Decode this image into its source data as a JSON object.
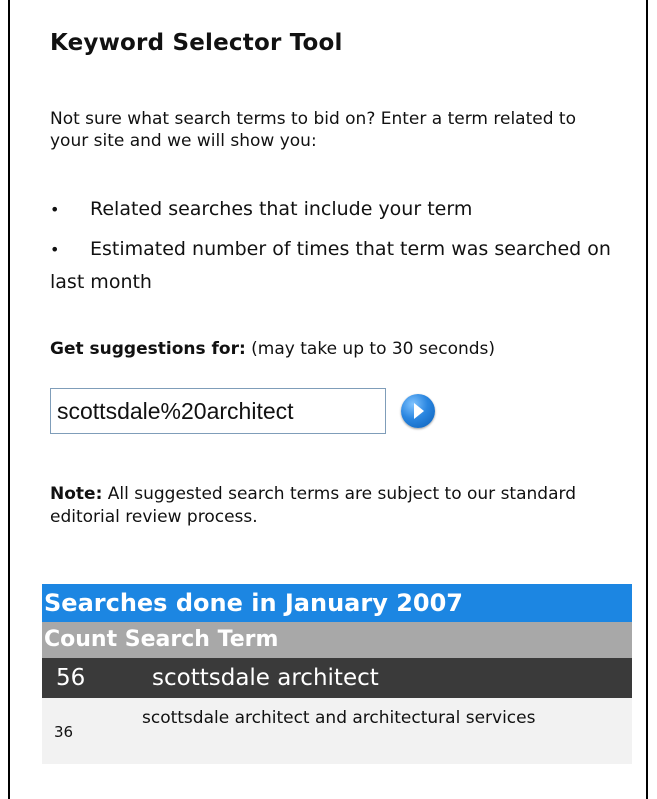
{
  "tool": {
    "title": "Keyword Selector Tool",
    "intro": "Not sure what search terms to bid on? Enter a term related to your site and we will show you:",
    "bullets": [
      "Related searches that include your term",
      "Estimated number of times that term was searched on last month"
    ],
    "bullet_glyph": "•"
  },
  "suggestions": {
    "label": "Get suggestions for:",
    "hint": "(may take up to 30 seconds)",
    "input_value": "scottsdale%20architect",
    "go_icon": "go-arrow-icon"
  },
  "note": {
    "label": "Note:",
    "text": "All suggested search terms are subject to our standard editorial review process."
  },
  "results": {
    "title": "Searches done in January 2007",
    "headers": [
      "Count",
      "Search Term"
    ],
    "rows": [
      {
        "count": "56",
        "term": "scottsdale architect"
      },
      {
        "count": "36",
        "term": "scottsdale architect and architectural services"
      }
    ]
  },
  "colors": {
    "title_bar": "#1c86e2",
    "header_bar": "#a8a8a8",
    "highlight_row": "#3a3a3a"
  }
}
